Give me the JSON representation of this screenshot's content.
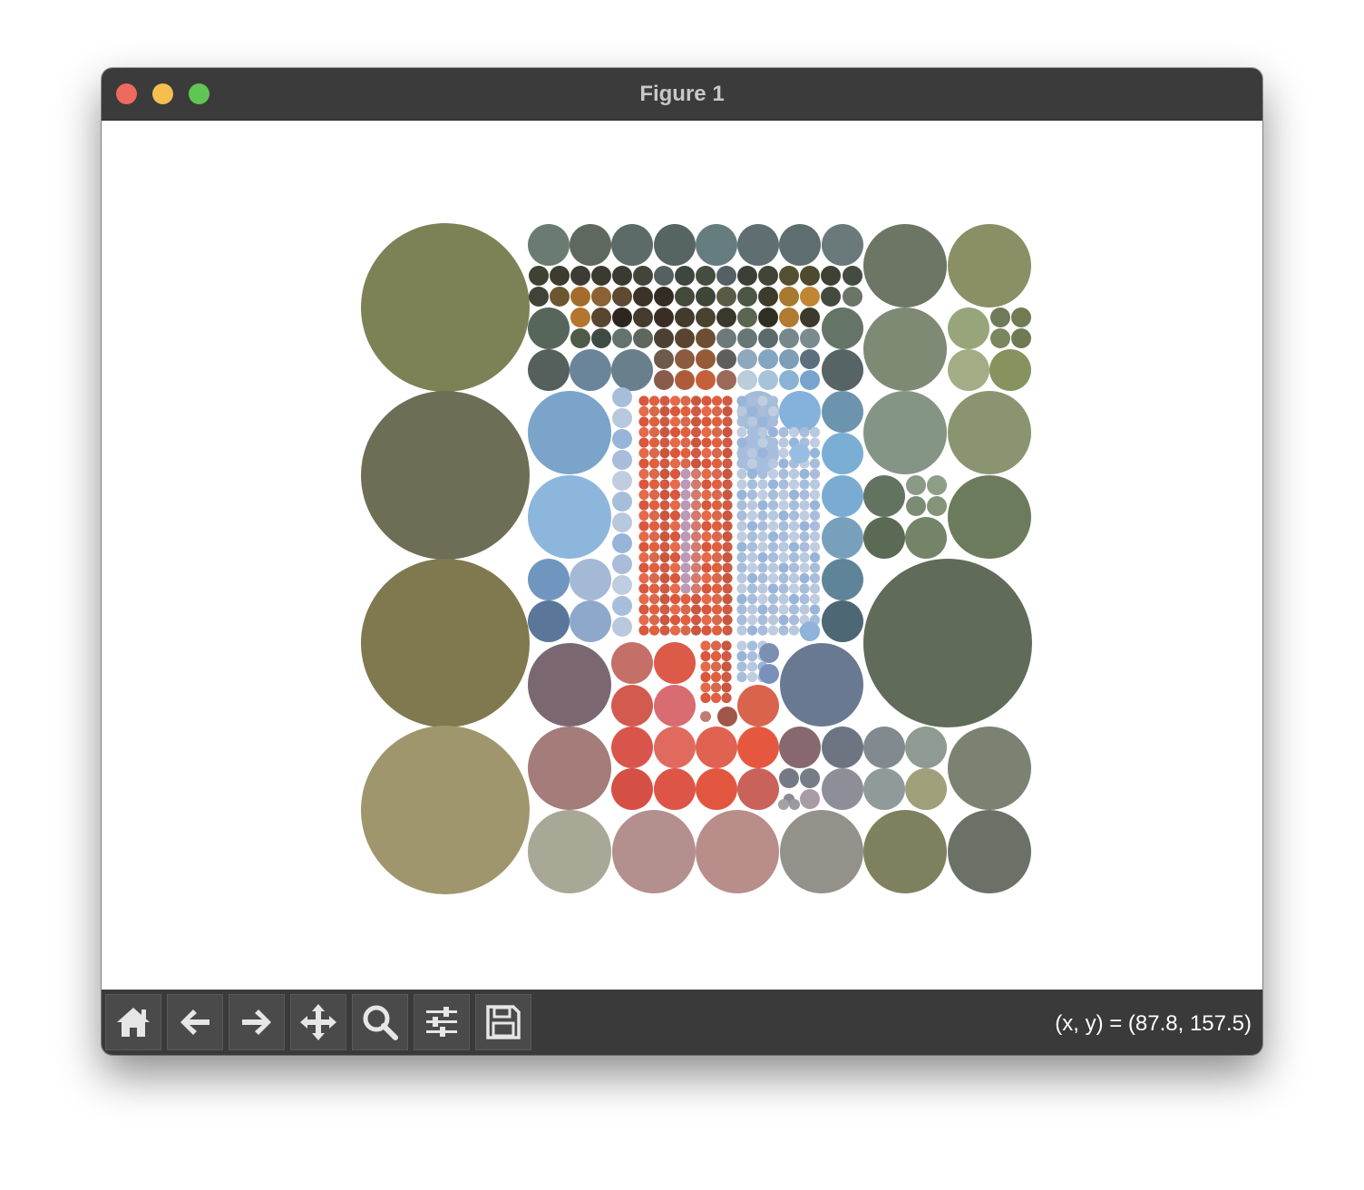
{
  "window": {
    "title": "Figure 1"
  },
  "toolbar": {
    "tools": [
      {
        "name": "home-icon",
        "label": "Home"
      },
      {
        "name": "back-icon",
        "label": "Back"
      },
      {
        "name": "forward-icon",
        "label": "Forward"
      },
      {
        "name": "pan-icon",
        "label": "Pan"
      },
      {
        "name": "zoom-icon",
        "label": "Zoom"
      },
      {
        "name": "configure-subplots-icon",
        "label": "Configure subplots"
      },
      {
        "name": "save-icon",
        "label": "Save"
      }
    ],
    "coords_readout": "(x, y) = (87.8, 157.5)"
  },
  "colors": {
    "titlebar": "#3b3b3b",
    "toolbar": "#3a3a3a",
    "tool_button": "#4a4a4a",
    "close": "#ed6a5e",
    "minimize": "#f4bf4f",
    "zoom": "#61c554"
  },
  "figure": {
    "description_kind": "circle-packing mosaic",
    "axes_visible": false,
    "grid": false
  }
}
